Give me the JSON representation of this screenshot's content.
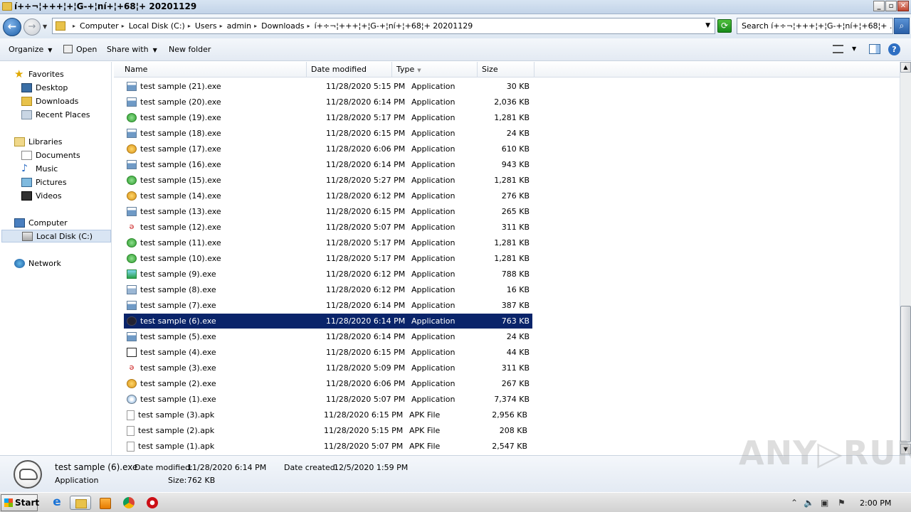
{
  "window": {
    "title": "í+÷¬¦+++¦+¦G-+¦ní+¦+68¦+ 20201129",
    "btn_min": "_",
    "btn_max": "▫",
    "btn_close": "✕"
  },
  "address": {
    "crumbs": [
      "Computer",
      "Local Disk (C:)",
      "Users",
      "admin",
      "Downloads",
      "í+÷¬¦+++¦+¦G-+¦ní+¦+68¦+ 20201129"
    ],
    "search_placeholder": "Search í+÷¬¦+++¦+¦G-+¦ní+¦+68¦+ ..."
  },
  "toolbar": {
    "organize": "Organize",
    "open": "Open",
    "share_with": "Share with",
    "new_folder": "New folder"
  },
  "nav": {
    "favorites": "Favorites",
    "desktop": "Desktop",
    "downloads": "Downloads",
    "recent_places": "Recent Places",
    "libraries": "Libraries",
    "documents": "Documents",
    "music": "Music",
    "pictures": "Pictures",
    "videos": "Videos",
    "computer": "Computer",
    "local_disk": "Local Disk (C:)",
    "network": "Network"
  },
  "columns": {
    "name": "Name",
    "date_modified": "Date modified",
    "type": "Type",
    "size": "Size"
  },
  "files": [
    {
      "name": "test sample (21).exe",
      "date": "11/28/2020 5:15 PM",
      "type": "Application",
      "size": "30 KB",
      "icon": "window-app-icon"
    },
    {
      "name": "test sample (20).exe",
      "date": "11/28/2020 6:14 PM",
      "type": "Application",
      "size": "2,036 KB",
      "icon": "window-app-icon"
    },
    {
      "name": "test sample (19).exe",
      "date": "11/28/2020 5:17 PM",
      "type": "Application",
      "size": "1,281 KB",
      "icon": "green-check-icon"
    },
    {
      "name": "test sample (18).exe",
      "date": "11/28/2020 6:15 PM",
      "type": "Application",
      "size": "24 KB",
      "icon": "window-app-icon"
    },
    {
      "name": "test sample (17).exe",
      "date": "11/28/2020 6:06 PM",
      "type": "Application",
      "size": "610 KB",
      "icon": "coins-icon"
    },
    {
      "name": "test sample (16).exe",
      "date": "11/28/2020 6:14 PM",
      "type": "Application",
      "size": "943 KB",
      "icon": "window-app-icon"
    },
    {
      "name": "test sample (15).exe",
      "date": "11/28/2020 5:27 PM",
      "type": "Application",
      "size": "1,281 KB",
      "icon": "green-check-icon"
    },
    {
      "name": "test sample (14).exe",
      "date": "11/28/2020 6:12 PM",
      "type": "Application",
      "size": "276 KB",
      "icon": "coins-icon"
    },
    {
      "name": "test sample (13).exe",
      "date": "11/28/2020 6:15 PM",
      "type": "Application",
      "size": "265 KB",
      "icon": "window-app-icon"
    },
    {
      "name": "test sample (12).exe",
      "date": "11/28/2020 5:07 PM",
      "type": "Application",
      "size": "311 KB",
      "icon": "red-swirl-icon"
    },
    {
      "name": "test sample (11).exe",
      "date": "11/28/2020 5:17 PM",
      "type": "Application",
      "size": "1,281 KB",
      "icon": "green-check-icon"
    },
    {
      "name": "test sample (10).exe",
      "date": "11/28/2020 5:17 PM",
      "type": "Application",
      "size": "1,281 KB",
      "icon": "green-check-icon"
    },
    {
      "name": "test sample (9).exe",
      "date": "11/28/2020 6:12 PM",
      "type": "Application",
      "size": "788 KB",
      "icon": "green-arrow-icon"
    },
    {
      "name": "test sample (8).exe",
      "date": "11/28/2020 6:12 PM",
      "type": "Application",
      "size": "16 KB",
      "icon": "gear-window-icon"
    },
    {
      "name": "test sample (7).exe",
      "date": "11/28/2020 6:14 PM",
      "type": "Application",
      "size": "387 KB",
      "icon": "window-app-icon"
    },
    {
      "name": "test sample (6).exe",
      "date": "11/28/2020 6:14 PM",
      "type": "Application",
      "size": "763 KB",
      "icon": "helmet-icon",
      "selected": true
    },
    {
      "name": "test sample (5).exe",
      "date": "11/28/2020 6:14 PM",
      "type": "Application",
      "size": "24 KB",
      "icon": "window-app-icon"
    },
    {
      "name": "test sample (4).exe",
      "date": "11/28/2020 6:15 PM",
      "type": "Application",
      "size": "44 KB",
      "icon": "black-window-icon"
    },
    {
      "name": "test sample (3).exe",
      "date": "11/28/2020 5:09 PM",
      "type": "Application",
      "size": "311 KB",
      "icon": "red-swirl-icon"
    },
    {
      "name": "test sample (2).exe",
      "date": "11/28/2020 6:06 PM",
      "type": "Application",
      "size": "267 KB",
      "icon": "coins-icon"
    },
    {
      "name": "test sample (1).exe",
      "date": "11/28/2020 5:07 PM",
      "type": "Application",
      "size": "7,374 KB",
      "icon": "cd-installer-icon"
    },
    {
      "name": "test sample (3).apk",
      "date": "11/28/2020 6:15 PM",
      "type": "APK File",
      "size": "2,956 KB",
      "icon": "blank-document-icon"
    },
    {
      "name": "test sample (2).apk",
      "date": "11/28/2020 5:15 PM",
      "type": "APK File",
      "size": "208 KB",
      "icon": "blank-document-icon"
    },
    {
      "name": "test sample (1).apk",
      "date": "11/28/2020 5:07 PM",
      "type": "APK File",
      "size": "2,547 KB",
      "icon": "blank-document-icon"
    }
  ],
  "details": {
    "file_name": "test sample (6).exe",
    "type": "Application",
    "date_modified_label": "Date modified:",
    "date_modified": "11/28/2020 6:14 PM",
    "size_label": "Size:",
    "size": "762 KB",
    "date_created_label": "Date created:",
    "date_created": "12/5/2020 1:59 PM"
  },
  "taskbar": {
    "start": "Start",
    "clock": "2:00 PM"
  },
  "watermark": "ANY▷RUN",
  "colors": {
    "selection": "#0a246a",
    "accent": "#2e6fc3"
  }
}
